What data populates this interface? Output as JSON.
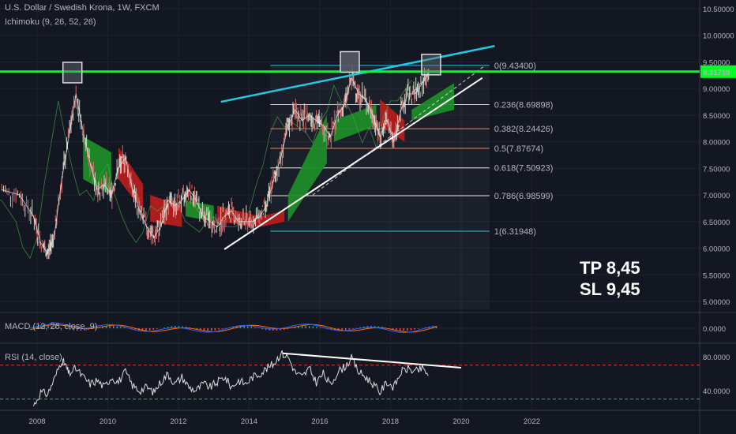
{
  "header": {
    "title": "U.S. Dollar / Swedish Krona, 1W, FXCM",
    "indicator": "Ichimoku (9, 26, 52, 26)"
  },
  "notes": {
    "tp": "TP 8,45",
    "sl": "SL 9,45"
  },
  "colors": {
    "background": "#131722",
    "grid": "#1f2330",
    "price_line": "#00ff22",
    "channel_top": "#1ec8e6",
    "trend_line": "#ffffff",
    "cloud_bull": "#1e8c28",
    "cloud_bear": "#b41e1e",
    "macd_line": "#2962ff",
    "signal_line": "#ff6d00",
    "rsi_line": "#dddddd",
    "rsi_upper": "#ff2a2a",
    "rsi_lower": "#00cc33"
  },
  "chart_data": [
    {
      "type": "line",
      "panel": "price",
      "title": "U.S. Dollar / Swedish Krona, 1W, FXCM",
      "x_ticks": [
        "2008",
        "2010",
        "2012",
        "2014",
        "2016",
        "2018",
        "2020",
        "2022"
      ],
      "y_ticks": [
        "10.50000",
        "10.00000",
        "9.50000",
        "9.00000",
        "8.50000",
        "8.00000",
        "7.50000",
        "7.00000",
        "6.50000",
        "6.00000",
        "5.50000",
        "5.00000"
      ],
      "ylim": [
        4.8,
        10.55
      ],
      "xlim": [
        2006.95,
        2026.75
      ],
      "current_price": {
        "label": "9.31710",
        "value": 9.3171
      },
      "fibonacci": [
        {
          "label": "0(9.43400)",
          "value": 9.434
        },
        {
          "label": "0.236(8.69898)",
          "value": 8.69898
        },
        {
          "label": "0.382(8.24426)",
          "value": 8.24426
        },
        {
          "label": "0.5(7.87674)",
          "value": 7.87674
        },
        {
          "label": "0.618(7.50923)",
          "value": 7.50923
        },
        {
          "label": "0.786(6.98599)",
          "value": 6.98599
        },
        {
          "label": "1(6.31948)",
          "value": 6.31948
        }
      ],
      "fib_range": {
        "x_start": 2014.6,
        "x_end": 2020.8
      },
      "price_points": [
        [
          2007.0,
          7.1
        ],
        [
          2007.5,
          7.0
        ],
        [
          2007.9,
          6.6
        ],
        [
          2008.1,
          6.1
        ],
        [
          2008.3,
          5.9
        ],
        [
          2008.5,
          6.3
        ],
        [
          2008.7,
          7.3
        ],
        [
          2008.9,
          8.1
        ],
        [
          2009.1,
          8.9
        ],
        [
          2009.3,
          8.2
        ],
        [
          2009.5,
          7.6
        ],
        [
          2009.7,
          7.1
        ],
        [
          2009.9,
          7.2
        ],
        [
          2010.1,
          7.0
        ],
        [
          2010.3,
          7.5
        ],
        [
          2010.5,
          7.7
        ],
        [
          2010.7,
          7.1
        ],
        [
          2010.9,
          6.7
        ],
        [
          2011.1,
          6.4
        ],
        [
          2011.3,
          6.2
        ],
        [
          2011.5,
          6.4
        ],
        [
          2011.7,
          6.9
        ],
        [
          2011.9,
          6.8
        ],
        [
          2012.1,
          6.9
        ],
        [
          2012.3,
          7.1
        ],
        [
          2012.5,
          6.9
        ],
        [
          2012.7,
          6.6
        ],
        [
          2012.9,
          6.5
        ],
        [
          2013.1,
          6.4
        ],
        [
          2013.3,
          6.6
        ],
        [
          2013.5,
          6.7
        ],
        [
          2013.7,
          6.5
        ],
        [
          2013.9,
          6.5
        ],
        [
          2014.1,
          6.5
        ],
        [
          2014.3,
          6.6
        ],
        [
          2014.5,
          6.8
        ],
        [
          2014.7,
          7.3
        ],
        [
          2014.9,
          7.7
        ],
        [
          2015.1,
          8.3
        ],
        [
          2015.3,
          8.6
        ],
        [
          2015.5,
          8.4
        ],
        [
          2015.7,
          8.5
        ],
        [
          2015.9,
          8.4
        ],
        [
          2016.1,
          8.3
        ],
        [
          2016.3,
          8.1
        ],
        [
          2016.5,
          8.5
        ],
        [
          2016.7,
          8.7
        ],
        [
          2016.9,
          9.2
        ],
        [
          2017.1,
          8.9
        ],
        [
          2017.3,
          8.8
        ],
        [
          2017.5,
          8.5
        ],
        [
          2017.7,
          8.1
        ],
        [
          2017.9,
          8.4
        ],
        [
          2018.1,
          8.0
        ],
        [
          2018.3,
          8.6
        ],
        [
          2018.5,
          8.9
        ],
        [
          2018.7,
          8.9
        ],
        [
          2018.9,
          9.1
        ],
        [
          2019.1,
          9.3
        ]
      ],
      "cloud_segments": [
        {
          "sentiment": "bull",
          "x": [
            2009.3,
            2010.1
          ],
          "upper": [
            8.1,
            7.8
          ],
          "lower": [
            7.3,
            7.0
          ]
        },
        {
          "sentiment": "bear",
          "x": [
            2010.3,
            2011.0
          ],
          "upper": [
            7.9,
            7.2
          ],
          "lower": [
            7.3,
            6.7
          ]
        },
        {
          "sentiment": "bear",
          "x": [
            2011.2,
            2012.1
          ],
          "upper": [
            7.0,
            6.8
          ],
          "lower": [
            6.5,
            6.4
          ]
        },
        {
          "sentiment": "bull",
          "x": [
            2012.2,
            2013.0
          ],
          "upper": [
            6.9,
            6.8
          ],
          "lower": [
            6.6,
            6.5
          ]
        },
        {
          "sentiment": "bear",
          "x": [
            2013.1,
            2014.3
          ],
          "upper": [
            6.8,
            6.6
          ],
          "lower": [
            6.5,
            6.4
          ]
        },
        {
          "sentiment": "bear",
          "x": [
            2014.3,
            2015.0
          ],
          "upper": [
            6.6,
            6.7
          ],
          "lower": [
            6.4,
            6.5
          ]
        },
        {
          "sentiment": "bull",
          "x": [
            2015.1,
            2016.2
          ],
          "upper": [
            7.0,
            8.5
          ],
          "lower": [
            6.5,
            7.6
          ]
        },
        {
          "sentiment": "bull",
          "x": [
            2016.4,
            2017.6
          ],
          "upper": [
            8.4,
            8.7
          ],
          "lower": [
            8.0,
            8.3
          ]
        },
        {
          "sentiment": "bear",
          "x": [
            2017.7,
            2018.4
          ],
          "upper": [
            8.8,
            8.4
          ],
          "lower": [
            8.3,
            8.0
          ]
        },
        {
          "sentiment": "bull",
          "x": [
            2018.6,
            2019.8
          ],
          "upper": [
            8.6,
            9.1
          ],
          "lower": [
            8.4,
            8.6
          ]
        }
      ],
      "drawings": {
        "resistance_line": {
          "from": [
            2013.2,
            8.75
          ],
          "to": [
            2020.95,
            9.8
          ]
        },
        "support_line": {
          "from": [
            2013.3,
            5.98
          ],
          "to": [
            2020.6,
            9.2
          ]
        },
        "dashed_line": {
          "from": [
            2015.8,
            7.0
          ],
          "to": [
            2020.65,
            9.42
          ]
        },
        "markers": [
          [
            2009.0,
            9.3
          ],
          [
            2016.85,
            9.5
          ],
          [
            2019.15,
            9.45
          ]
        ]
      }
    },
    {
      "type": "line",
      "panel": "macd",
      "title": "MACD (12, 26, close, 9)",
      "y_ticks": [
        "0.0000"
      ],
      "ylim": [
        -0.5,
        0.5
      ]
    },
    {
      "type": "line",
      "panel": "rsi",
      "title": "RSI (14, close)",
      "y_ticks": [
        "80.0000",
        "40.0000"
      ],
      "ylim": [
        15,
        88
      ],
      "levels": [
        70,
        30
      ],
      "rsi_points": [
        [
          2007.9,
          22
        ],
        [
          2008.1,
          38
        ],
        [
          2008.3,
          36
        ],
        [
          2008.5,
          55
        ],
        [
          2008.7,
          76
        ],
        [
          2008.8,
          70
        ],
        [
          2008.9,
          60
        ],
        [
          2009.1,
          66
        ],
        [
          2009.3,
          56
        ],
        [
          2009.5,
          48
        ],
        [
          2009.7,
          52
        ],
        [
          2009.9,
          44
        ],
        [
          2010.1,
          56
        ],
        [
          2010.3,
          50
        ],
        [
          2010.5,
          62
        ],
        [
          2010.7,
          46
        ],
        [
          2010.9,
          40
        ],
        [
          2011.1,
          44
        ],
        [
          2011.3,
          38
        ],
        [
          2011.5,
          50
        ],
        [
          2011.7,
          60
        ],
        [
          2011.9,
          48
        ],
        [
          2012.1,
          56
        ],
        [
          2012.3,
          44
        ],
        [
          2012.5,
          40
        ],
        [
          2012.7,
          48
        ],
        [
          2012.9,
          44
        ],
        [
          2013.1,
          50
        ],
        [
          2013.3,
          56
        ],
        [
          2013.5,
          44
        ],
        [
          2013.7,
          52
        ],
        [
          2013.9,
          48
        ],
        [
          2014.1,
          56
        ],
        [
          2014.3,
          60
        ],
        [
          2014.5,
          66
        ],
        [
          2014.7,
          72
        ],
        [
          2014.9,
          84
        ],
        [
          2015.1,
          80
        ],
        [
          2015.3,
          62
        ],
        [
          2015.5,
          56
        ],
        [
          2015.7,
          66
        ],
        [
          2015.9,
          50
        ],
        [
          2016.1,
          60
        ],
        [
          2016.3,
          46
        ],
        [
          2016.5,
          62
        ],
        [
          2016.7,
          68
        ],
        [
          2016.9,
          78
        ],
        [
          2017.1,
          62
        ],
        [
          2017.3,
          56
        ],
        [
          2017.5,
          48
        ],
        [
          2017.7,
          38
        ],
        [
          2017.9,
          50
        ],
        [
          2018.1,
          44
        ],
        [
          2018.3,
          62
        ],
        [
          2018.5,
          66
        ],
        [
          2018.7,
          62
        ],
        [
          2018.9,
          66
        ],
        [
          2019.1,
          58
        ]
      ],
      "trend_line": {
        "from": [
          2014.95,
          84
        ],
        "to": [
          2020.0,
          67
        ]
      }
    }
  ]
}
